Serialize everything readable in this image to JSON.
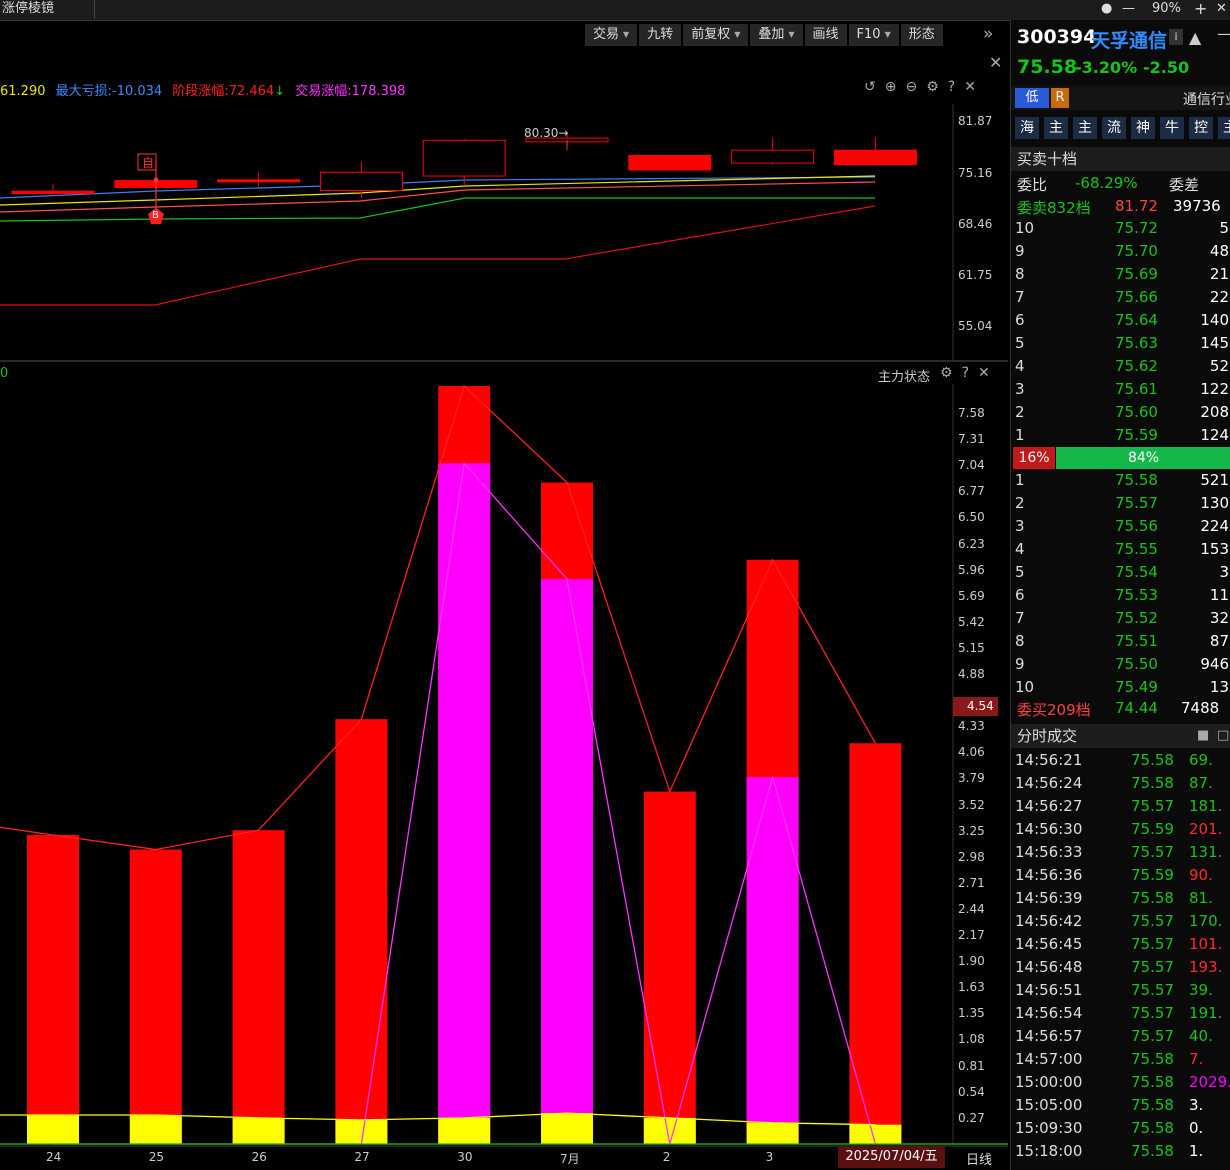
{
  "window": {
    "tab_title": "涨停棱镜",
    "zoom": "90%",
    "min_icon": "minus-icon",
    "add_icon": "plus-icon",
    "close_icon": "close-icon"
  },
  "toolbar": {
    "items": [
      {
        "label": "交易",
        "dropdown": true
      },
      {
        "label": "九转",
        "dropdown": false
      },
      {
        "label": "前复权",
        "dropdown": true
      },
      {
        "label": "叠加",
        "dropdown": true
      },
      {
        "label": "画线",
        "dropdown": false
      },
      {
        "label": "F10",
        "dropdown": true
      },
      {
        "label": "形态",
        "dropdown": false
      }
    ]
  },
  "price_panel": {
    "stats": {
      "first": "61.290",
      "max_loss": "最大亏损:-10.034",
      "stage_gain": "阶段涨幅:72.464",
      "stage_arrow": "↓",
      "trade_gain": "交易涨幅:178.398"
    },
    "y_ticks": [
      "81.87",
      "75.16",
      "68.46",
      "61.75",
      "55.04"
    ],
    "annot_top": "80.30→",
    "marker_zi": "自",
    "marker_b": "B",
    "candles": [
      {
        "o": 72.2,
        "c": 72.5,
        "h": 73.4,
        "l": 71.8,
        "color": "#ff0000",
        "filled": true
      },
      {
        "o": 73.0,
        "c": 73.9,
        "h": 76.5,
        "l": 70.2,
        "color": "#ff0000",
        "filled": true
      },
      {
        "o": 73.8,
        "c": 74.0,
        "h": 75.0,
        "l": 73.0,
        "color": "#ff0000",
        "filled": true
      },
      {
        "o": 72.6,
        "c": 75.0,
        "h": 76.4,
        "l": 71.6,
        "color": "#ff0000",
        "filled": false
      },
      {
        "o": 74.5,
        "c": 79.2,
        "h": 79.4,
        "l": 73.2,
        "color": "#ff0000",
        "filled": false
      },
      {
        "o": 79.0,
        "c": 79.5,
        "h": 80.3,
        "l": 78.5,
        "color": "#ff0000",
        "filled": false
      },
      {
        "o": 75.3,
        "c": 77.2,
        "h": 77.2,
        "l": 75.3,
        "color": "#ff0000",
        "filled": true
      },
      {
        "o": 76.2,
        "c": 77.9,
        "h": 79.5,
        "l": 76.0,
        "color": "#ff0000",
        "filled": false
      },
      {
        "o": 76.0,
        "c": 77.9,
        "h": 79.6,
        "l": 76.0,
        "color": "#ff0000",
        "filled": true
      }
    ]
  },
  "indicator_panel": {
    "name": "主力状态",
    "left_value": "0",
    "current_value": "4.54",
    "y_ticks": [
      "7.58",
      "7.31",
      "7.04",
      "6.77",
      "6.50",
      "6.23",
      "5.96",
      "5.69",
      "5.42",
      "5.15",
      "4.88",
      "4.33",
      "4.06",
      "3.79",
      "3.52",
      "3.25",
      "2.98",
      "2.71",
      "2.44",
      "2.17",
      "1.90",
      "1.63",
      "1.35",
      "1.08",
      "0.81",
      "0.54",
      "0.27"
    ],
    "x_labels": [
      "24",
      "25",
      "26",
      "27",
      "30",
      "7月",
      "2",
      "3"
    ],
    "date_label": "2025/07/04/五",
    "period_label": "日线"
  },
  "chart_data": {
    "type": "bar",
    "categories": [
      "24",
      "25",
      "26",
      "27",
      "30",
      "7月",
      "2",
      "3",
      "2025/07/04/五"
    ],
    "series": [
      {
        "values": [
          3.2,
          3.05,
          3.25,
          4.4,
          7.85,
          6.85,
          3.65,
          6.05,
          4.15
        ]
      },
      {
        "values": [
          0,
          0,
          0,
          0,
          7.05,
          5.85,
          0,
          3.8,
          0
        ]
      },
      {
        "values": [
          0.3,
          0.3,
          0.27,
          0.25,
          0.27,
          0.32,
          0.27,
          0.22,
          0.2
        ]
      }
    ],
    "ylim": [
      0,
      7.85
    ]
  },
  "stock": {
    "code": "300394",
    "name": "天孚通信",
    "price": "75.58",
    "change_pct": "-3.20%",
    "change": "-2.50",
    "industry": "通信行业",
    "tag_low": "低",
    "tag_r": "R",
    "concept_tags": [
      "海",
      "主",
      "主",
      "流",
      "神",
      "牛",
      "控",
      "主"
    ]
  },
  "orderbook": {
    "title": "买卖十档",
    "ratio_label": "委比",
    "ratio_value": "-68.29%",
    "diff_label": "委差",
    "sell_total_label": "委卖832档",
    "sell_total_price": "81.72",
    "sell_total_vol": "39736",
    "sells": [
      {
        "lv": "10",
        "price": "75.72",
        "vol": "5"
      },
      {
        "lv": "9",
        "price": "75.70",
        "vol": "48"
      },
      {
        "lv": "8",
        "price": "75.69",
        "vol": "21"
      },
      {
        "lv": "7",
        "price": "75.66",
        "vol": "22"
      },
      {
        "lv": "6",
        "price": "75.64",
        "vol": "140"
      },
      {
        "lv": "5",
        "price": "75.63",
        "vol": "145"
      },
      {
        "lv": "4",
        "price": "75.62",
        "vol": "52"
      },
      {
        "lv": "3",
        "price": "75.61",
        "vol": "122"
      },
      {
        "lv": "2",
        "price": "75.60",
        "vol": "208"
      },
      {
        "lv": "1",
        "price": "75.59",
        "vol": "124"
      }
    ],
    "bar_red": "16%",
    "bar_green": "84%",
    "buys": [
      {
        "lv": "1",
        "price": "75.58",
        "vol": "521"
      },
      {
        "lv": "2",
        "price": "75.57",
        "vol": "130"
      },
      {
        "lv": "3",
        "price": "75.56",
        "vol": "224"
      },
      {
        "lv": "4",
        "price": "75.55",
        "vol": "153"
      },
      {
        "lv": "5",
        "price": "75.54",
        "vol": "3"
      },
      {
        "lv": "6",
        "price": "75.53",
        "vol": "11"
      },
      {
        "lv": "7",
        "price": "75.52",
        "vol": "32"
      },
      {
        "lv": "8",
        "price": "75.51",
        "vol": "87"
      },
      {
        "lv": "9",
        "price": "75.50",
        "vol": "946"
      },
      {
        "lv": "10",
        "price": "75.49",
        "vol": "13"
      }
    ],
    "buy_total_label": "委买209档",
    "buy_total_price": "74.44",
    "buy_total_vol": "7488"
  },
  "ticks": {
    "title": "分时成交",
    "rows": [
      {
        "t": "14:56:21",
        "p": "75.58",
        "v": "69.",
        "c": "#18c418"
      },
      {
        "t": "14:56:24",
        "p": "75.58",
        "v": "87.",
        "c": "#18c418"
      },
      {
        "t": "14:56:27",
        "p": "75.57",
        "v": "181.",
        "c": "#18c418"
      },
      {
        "t": "14:56:30",
        "p": "75.59",
        "v": "201.",
        "c": "#ff2a2a"
      },
      {
        "t": "14:56:33",
        "p": "75.57",
        "v": "131.",
        "c": "#18c418"
      },
      {
        "t": "14:56:36",
        "p": "75.59",
        "v": "90.",
        "c": "#ff2a2a"
      },
      {
        "t": "14:56:39",
        "p": "75.58",
        "v": "81.",
        "c": "#18c418"
      },
      {
        "t": "14:56:42",
        "p": "75.57",
        "v": "170.",
        "c": "#18c418"
      },
      {
        "t": "14:56:45",
        "p": "75.57",
        "v": "101.",
        "c": "#ff2a2a"
      },
      {
        "t": "14:56:48",
        "p": "75.57",
        "v": "193.",
        "c": "#ff2a2a"
      },
      {
        "t": "14:56:51",
        "p": "75.57",
        "v": "39.",
        "c": "#18c418"
      },
      {
        "t": "14:56:54",
        "p": "75.57",
        "v": "191.",
        "c": "#18c418"
      },
      {
        "t": "14:56:57",
        "p": "75.57",
        "v": "40.",
        "c": "#18c418"
      },
      {
        "t": "14:57:00",
        "p": "75.58",
        "v": "7.",
        "c": "#ff2a2a"
      },
      {
        "t": "15:00:00",
        "p": "75.58",
        "v": "2029.",
        "c": "#ff00ff"
      },
      {
        "t": "15:05:00",
        "p": "75.58",
        "v": "3.",
        "c": "#ffffff"
      },
      {
        "t": "15:09:30",
        "p": "75.58",
        "v": "0.",
        "c": "#ffffff"
      },
      {
        "t": "15:18:00",
        "p": "75.58",
        "v": "1.",
        "c": "#ffffff"
      }
    ]
  }
}
